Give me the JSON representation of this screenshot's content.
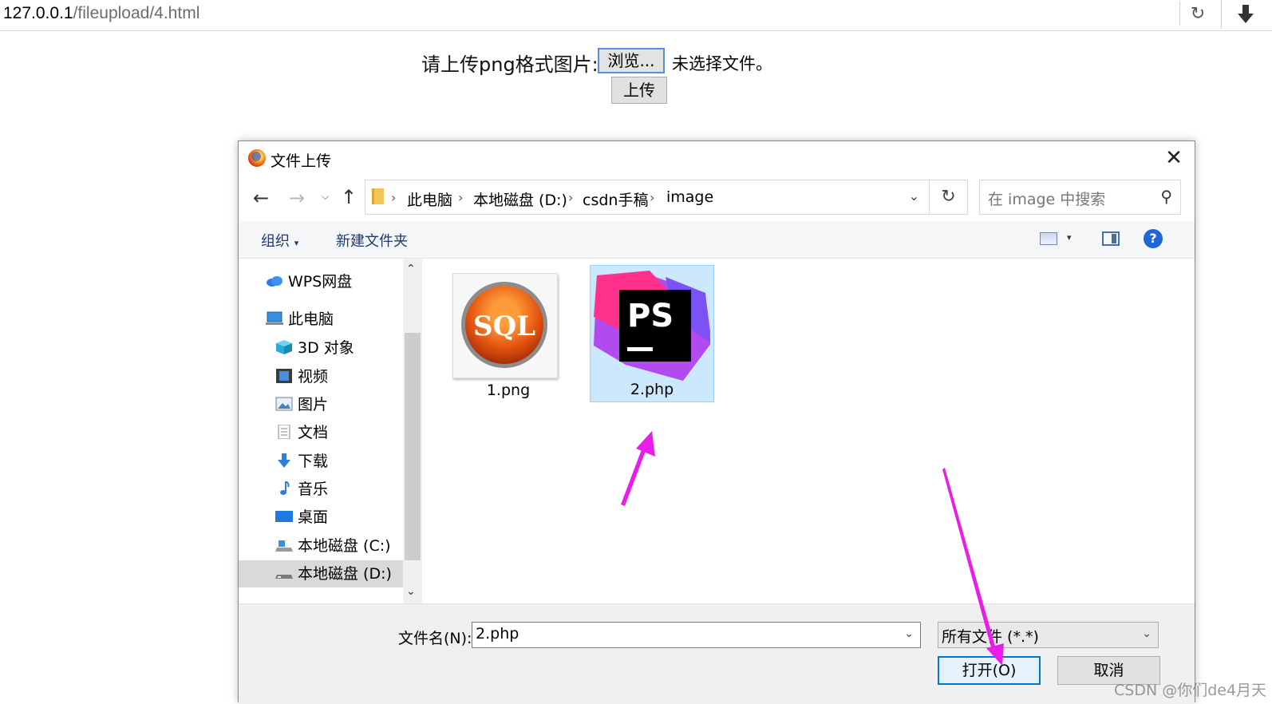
{
  "browser": {
    "url_host": "127.0.0.1",
    "url_path": "/fileupload/4.html",
    "reload_icon": "reload-icon",
    "download_icon": "download-arrow-icon"
  },
  "page": {
    "label": "请上传png格式图片:",
    "browse_button": "浏览...",
    "no_file_text": "未选择文件。",
    "submit_button": "上传"
  },
  "dialog": {
    "title": "文件上传",
    "close_icon": "close-icon",
    "breadcrumb": [
      "此电脑",
      "本地磁盘 (D:)",
      "csdn手稿",
      "image"
    ],
    "search_placeholder": "在 image 中搜索",
    "toolbar": {
      "organize_label": "组织",
      "new_folder_label": "新建文件夹"
    },
    "nav_items": [
      {
        "label": "WPS网盘",
        "icon": "cloud-icon"
      },
      {
        "label": "此电脑",
        "icon": "computer-icon"
      },
      {
        "label": "3D 对象",
        "icon": "cube-3d-icon"
      },
      {
        "label": "视频",
        "icon": "video-icon"
      },
      {
        "label": "图片",
        "icon": "picture-icon"
      },
      {
        "label": "文档",
        "icon": "document-icon"
      },
      {
        "label": "下载",
        "icon": "download-icon"
      },
      {
        "label": "音乐",
        "icon": "music-icon"
      },
      {
        "label": "桌面",
        "icon": "desktop-icon"
      },
      {
        "label": "本地磁盘 (C:)",
        "icon": "drive-icon"
      },
      {
        "label": "本地磁盘 (D:)",
        "icon": "drive-icon",
        "selected": true
      }
    ],
    "files": [
      {
        "name": "1.png",
        "icon": "sql-image-thumbnail"
      },
      {
        "name": "2.php",
        "icon": "phpstorm-icon",
        "selected": true
      }
    ],
    "filename_label": "文件名(N):",
    "filename_value": "2.php",
    "filetype_value": "所有文件 (*.*)",
    "open_button": "打开(O)",
    "cancel_button": "取消"
  },
  "watermark": "CSDN @你们de4月天",
  "colors": {
    "annotation_arrow": "#e81ee8",
    "selection_bg": "#cce8ff",
    "open_button_border": "#0078d7"
  }
}
